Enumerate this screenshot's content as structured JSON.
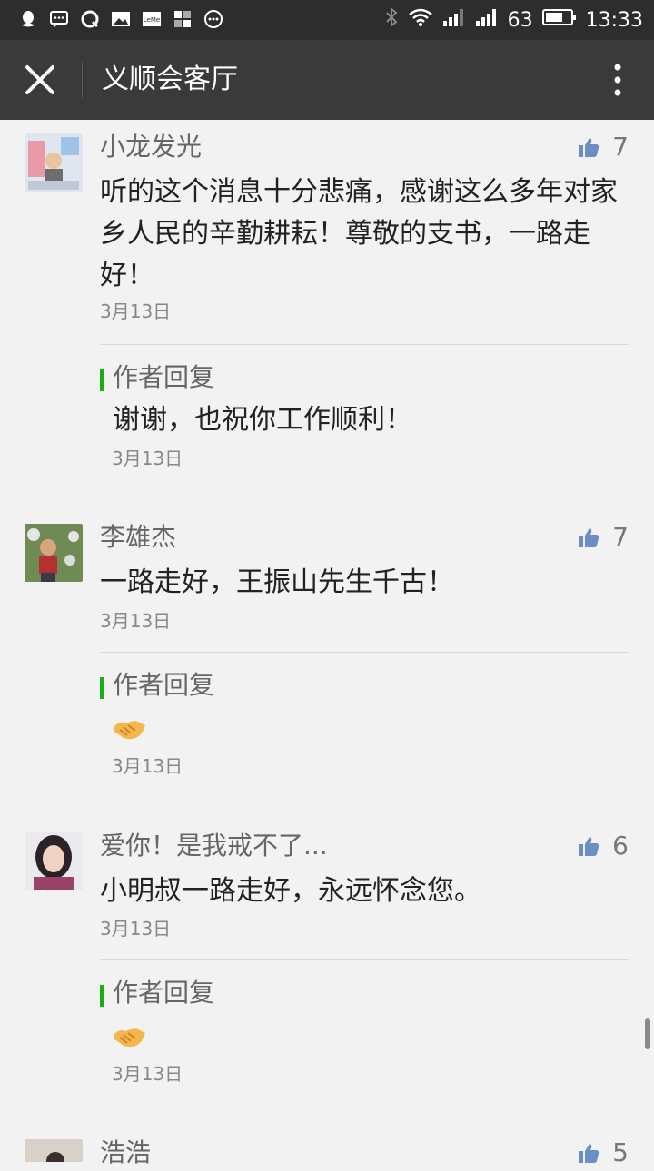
{
  "status_bar": {
    "battery": "63",
    "time": "13:33",
    "left_icons": [
      "qq-icon",
      "message-icon",
      "qq-browser-icon",
      "gallery-icon",
      "leme-icon",
      "apps-icon",
      "more-dots-icon"
    ],
    "right_icons": [
      "bluetooth-icon",
      "wifi-icon",
      "signal-icon",
      "signal-icon",
      "battery-icon"
    ]
  },
  "header": {
    "title": "义顺会客厅"
  },
  "comments": [
    {
      "nickname": "小龙发光",
      "likes": "7",
      "text": "听的这个消息十分悲痛，感谢这么多年对家乡人民的辛勤耕耘！尊敬的支书，一路走好！",
      "date": "3月13日",
      "reply": {
        "label": "作者回复",
        "text": "谢谢，也祝你工作顺利！",
        "date": "3月13日"
      }
    },
    {
      "nickname": "李雄杰",
      "likes": "7",
      "text": "一路走好，王振山先生千古！",
      "date": "3月13日",
      "reply": {
        "label": "作者回复",
        "text": "",
        "emoji": "handshake",
        "date": "3月13日"
      }
    },
    {
      "nickname": "爱你！是我戒不了...",
      "likes": "6",
      "text": "小明叔一路走好，永远怀念您。",
      "date": "3月13日",
      "reply": {
        "label": "作者回复",
        "text": "",
        "emoji": "handshake",
        "date": "3月13日"
      }
    },
    {
      "nickname": "浩浩",
      "likes": "5"
    }
  ],
  "colors": {
    "accent_green": "#1aad19",
    "like_blue": "#6b8fc4",
    "titlebar": "#3a3a3a",
    "statusbar": "#2d2d2d"
  }
}
